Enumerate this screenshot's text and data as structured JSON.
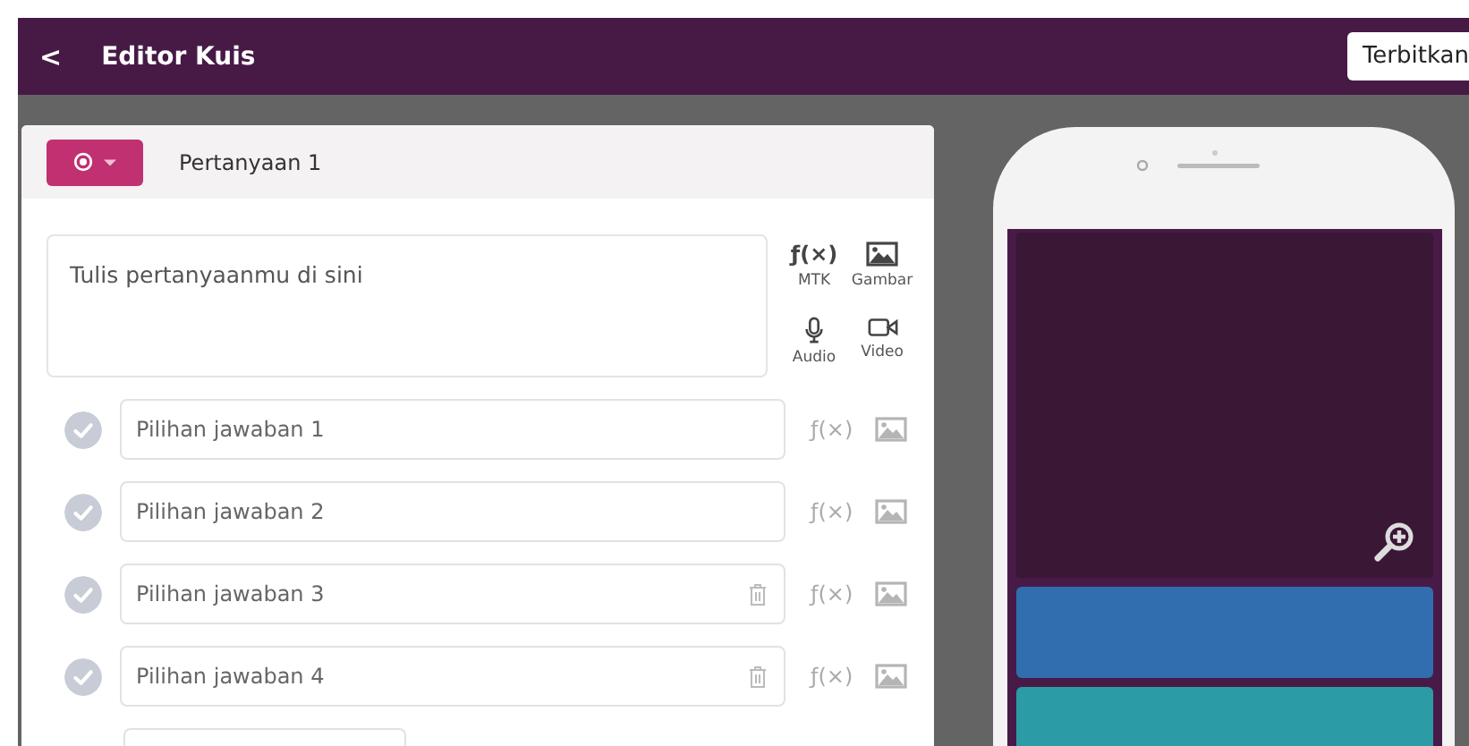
{
  "header": {
    "back": "<",
    "title": "Editor Kuis",
    "publish_button": "Terbitkan"
  },
  "question": {
    "type_button": {
      "kind": "multiple-choice"
    },
    "label": "Pertanyaan 1",
    "placeholder": "Tulis pertanyaanmu di sini",
    "media": [
      {
        "kind": "math",
        "label": "MTK",
        "glyph": "ƒ(×)"
      },
      {
        "kind": "image",
        "label": "Gambar"
      },
      {
        "kind": "audio",
        "label": "Audio"
      },
      {
        "kind": "video",
        "label": "Video"
      }
    ]
  },
  "choices": [
    {
      "placeholder": "Pilihan jawaban 1",
      "correct": false,
      "deletable": false,
      "math": "ƒ(×)"
    },
    {
      "placeholder": "Pilihan jawaban 2",
      "correct": false,
      "deletable": false,
      "math": "ƒ(×)"
    },
    {
      "placeholder": "Pilihan jawaban 3",
      "correct": false,
      "deletable": true,
      "math": "ƒ(×)"
    },
    {
      "placeholder": "Pilihan jawaban 4",
      "correct": false,
      "deletable": true,
      "math": "ƒ(×)"
    }
  ],
  "preview": {
    "answer_tiles": [
      {
        "color": "#306eb0"
      },
      {
        "color": "#2b9ba5"
      }
    ]
  }
}
